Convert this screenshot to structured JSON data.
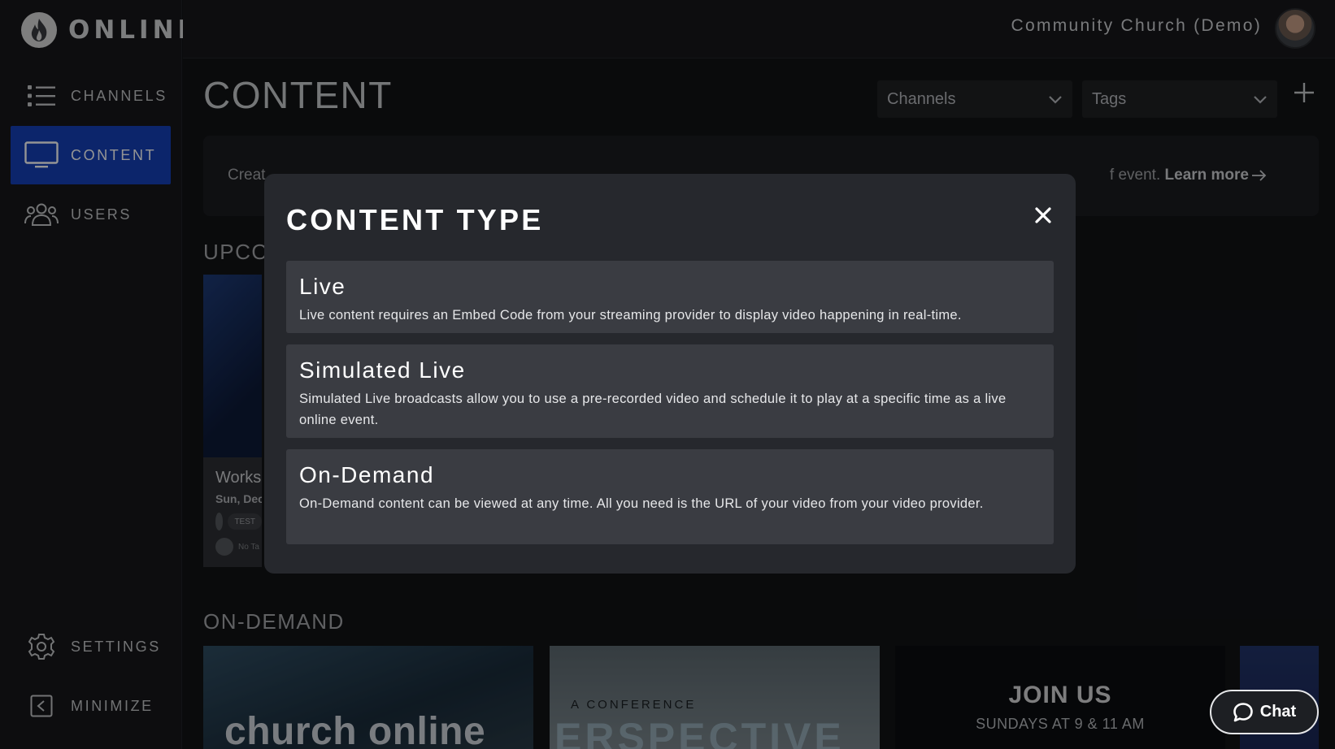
{
  "brand": {
    "logo_text": "ONLINE"
  },
  "header": {
    "org_name": "Community Church (Demo)"
  },
  "sidebar": {
    "items": [
      {
        "label": "CHANNELS",
        "icon": "list-icon",
        "active": false
      },
      {
        "label": "CONTENT",
        "icon": "monitor-icon",
        "active": true
      },
      {
        "label": "USERS",
        "icon": "users-icon",
        "active": false
      }
    ],
    "settings_label": "SETTINGS",
    "minimize_label": "MINIMIZE"
  },
  "main": {
    "title": "CONTENT",
    "filters": {
      "channels": "Channels",
      "tags": "Tags"
    },
    "info": {
      "visible_start": "Creat",
      "visible_end": "f event.",
      "learn_more": "Learn more"
    },
    "upcoming": {
      "label": "UPCO",
      "card": {
        "title": "Works",
        "date": "Sun, Dec",
        "channel_chip": "TEST",
        "tags": "No Ta"
      }
    },
    "on_demand": {
      "label": "ON-DEMAND",
      "cards": [
        {
          "text": "church online"
        },
        {
          "small": "A CONFERENCE",
          "big": "ERSPECTIVE"
        },
        {
          "big": "JOIN US",
          "sub": "SUNDAYS AT 9 & 11 AM"
        }
      ]
    }
  },
  "modal": {
    "title": "CONTENT TYPE",
    "options": [
      {
        "name": "Live",
        "description": "Live content requires an Embed Code from your streaming provider to display video happening in real-time."
      },
      {
        "name": "Simulated Live",
        "description": "Simulated Live broadcasts allow you to use a pre-recorded video and schedule it to play at a specific time as a live online event."
      },
      {
        "name": "On-Demand",
        "description": "On-Demand content can be viewed at any time. All you need is the URL of your video from your video provider."
      }
    ]
  },
  "chat": {
    "label": "Chat"
  },
  "colors": {
    "accent": "#1541b8",
    "background": "#121316",
    "modal": "#26282d",
    "option": "#3a3c42"
  }
}
